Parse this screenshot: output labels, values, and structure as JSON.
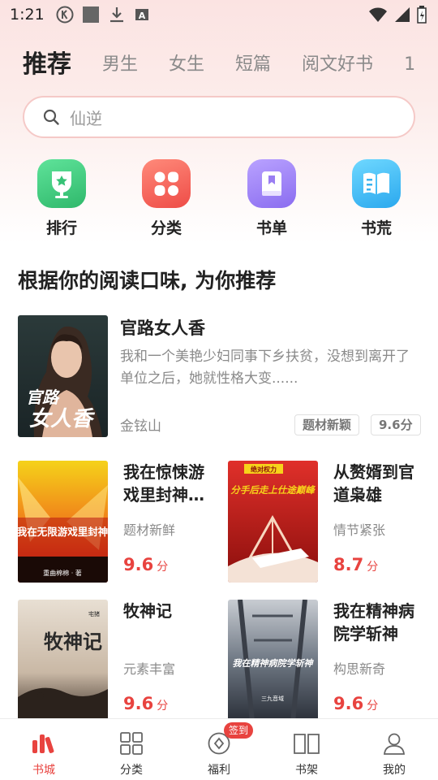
{
  "status_bar": {
    "time": "1:21",
    "icons_left": [
      "k-circle-icon",
      "square-icon",
      "download-icon",
      "a-box-icon"
    ],
    "icons_right": [
      "wifi-icon",
      "signal-icon",
      "battery-icon"
    ]
  },
  "tabs": [
    {
      "label": "推荐",
      "active": true
    },
    {
      "label": "男生",
      "active": false
    },
    {
      "label": "女生",
      "active": false
    },
    {
      "label": "短篇",
      "active": false
    },
    {
      "label": "阅文好书",
      "active": false
    },
    {
      "label": "1",
      "active": false
    }
  ],
  "search": {
    "placeholder": "仙逆",
    "icon": "search-icon"
  },
  "quick_entries": [
    {
      "label": "排行",
      "icon": "trophy-icon",
      "color": "#3cc47c"
    },
    {
      "label": "分类",
      "icon": "grid-icon",
      "color": "#f0524d"
    },
    {
      "label": "书单",
      "icon": "book-list-icon",
      "color": "#9b7cf0"
    },
    {
      "label": "书荒",
      "icon": "open-book-icon",
      "color": "#30b8f0"
    }
  ],
  "section_title": "根据你的阅读口味, 为你推荐",
  "featured": {
    "title": "官路女人香",
    "description": "我和一个美艳少妇同事下乡扶贫，没想到离开了单位之后，她就性格大变......",
    "author": "金铉山",
    "tags": [
      "题材新颖",
      "9.6分"
    ],
    "cover_text": [
      "官路",
      "女人香"
    ]
  },
  "grid_books": [
    {
      "title": "我在惊悚游戏里封神…",
      "tag": "题材新鲜",
      "score": "9.6",
      "unit": "分",
      "cover_text": "我在无限游戏里封神",
      "cover_author": "重曲棉棉 · 著"
    },
    {
      "title": "从赘婿到官道枭雄",
      "tag": "情节紧张",
      "score": "8.7",
      "unit": "分",
      "cover_text": "分手后走上仕途巅峰",
      "cover_author": "绝对权力"
    },
    {
      "title": "牧神记",
      "tag": "元素丰富",
      "score": "9.6",
      "unit": "分",
      "cover_text": "牧神记",
      "cover_author": "宅猪"
    },
    {
      "title": "我在精神病院学斩神",
      "tag": "构思新奇",
      "score": "9.6",
      "unit": "分",
      "cover_text": "我在精神病院学斩神",
      "cover_author": "三九音域"
    }
  ],
  "bottom_nav": [
    {
      "label": "书城",
      "icon": "bookstore-icon",
      "active": true
    },
    {
      "label": "分类",
      "icon": "category-grid-icon",
      "active": false
    },
    {
      "label": "福利",
      "icon": "welfare-icon",
      "active": false,
      "badge": "签到"
    },
    {
      "label": "书架",
      "icon": "bookshelf-icon",
      "active": false
    },
    {
      "label": "我的",
      "icon": "profile-icon",
      "active": false
    }
  ],
  "colors": {
    "accent": "#e8433f",
    "top_gradient": "#fbe3e2"
  }
}
